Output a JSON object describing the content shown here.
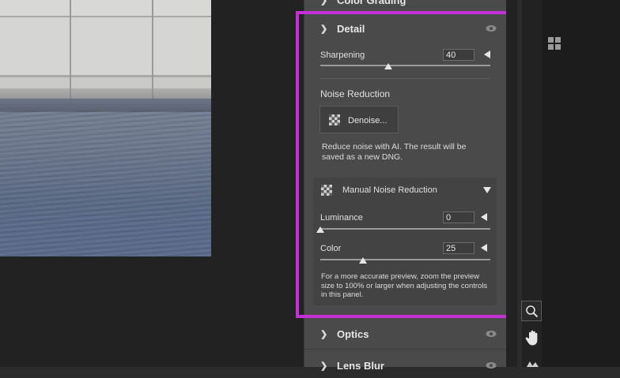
{
  "sections": {
    "color_grading": {
      "label": "Color Grading"
    },
    "detail": {
      "label": "Detail"
    },
    "optics": {
      "label": "Optics"
    },
    "lens_blur": {
      "label": "Lens Blur"
    }
  },
  "detail": {
    "sharpening": {
      "label": "Sharpening",
      "value": "40"
    },
    "noise_reduction_heading": "Noise Reduction",
    "denoise_button": "Denoise...",
    "denoise_description": "Reduce noise with AI. The result will be saved as a new DNG.",
    "manual_noise_reduction": {
      "label": "Manual Noise Reduction",
      "luminance": {
        "label": "Luminance",
        "value": "0"
      },
      "color": {
        "label": "Color",
        "value": "25"
      },
      "note": "For a more accurate preview, zoom the preview size to 100% or larger when adjusting the controls in this panel."
    }
  },
  "slider_levels": {
    "sharpening": 0.4,
    "luminance": 0.0,
    "color": 0.25
  },
  "icons": {
    "eye": "eye-icon",
    "grid": "grid-view-icon",
    "zoom": "zoom-icon",
    "hand": "hand-tool-icon"
  },
  "colors": {
    "highlight": "#c42fd6",
    "panel": "#4a4a4a"
  }
}
